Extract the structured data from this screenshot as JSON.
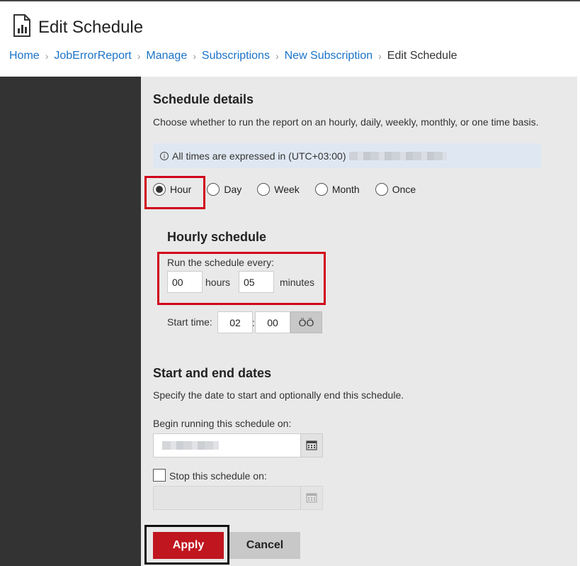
{
  "page": {
    "title": "Edit Schedule",
    "icon": "report-icon"
  },
  "breadcrumb": [
    {
      "label": "Home"
    },
    {
      "label": "JobErrorReport"
    },
    {
      "label": "Manage"
    },
    {
      "label": "Subscriptions"
    },
    {
      "label": "New Subscription"
    },
    {
      "label": "Edit Schedule"
    }
  ],
  "schedule_details": {
    "heading": "Schedule details",
    "description": "Choose whether to run the report on an hourly, daily, weekly, monthly, or one time basis.",
    "timezone_note": "All times are expressed in (UTC+03:00)",
    "frequency_options": [
      "Hour",
      "Day",
      "Week",
      "Month",
      "Once"
    ],
    "selected_frequency": "Hour"
  },
  "hourly": {
    "heading": "Hourly schedule",
    "run_every_label": "Run the schedule every:",
    "hours_value": "00",
    "hours_unit": "hours",
    "minutes_value": "05",
    "minutes_unit": "minutes",
    "start_time_label": "Start time:",
    "start_hour": "02",
    "time_separator": ":",
    "start_minute": "00",
    "ampm_label": "ÖÖ"
  },
  "dates": {
    "heading": "Start and end dates",
    "description": "Specify the date to start and optionally end this schedule.",
    "begin_label": "Begin running this schedule on:",
    "stop_label": "Stop this schedule on:",
    "stop_checked": false
  },
  "actions": {
    "apply": "Apply",
    "cancel": "Cancel"
  },
  "colors": {
    "accent_link": "#1a73c8",
    "apply_button": "#c0161f",
    "highlight_box": "#d0021b"
  }
}
